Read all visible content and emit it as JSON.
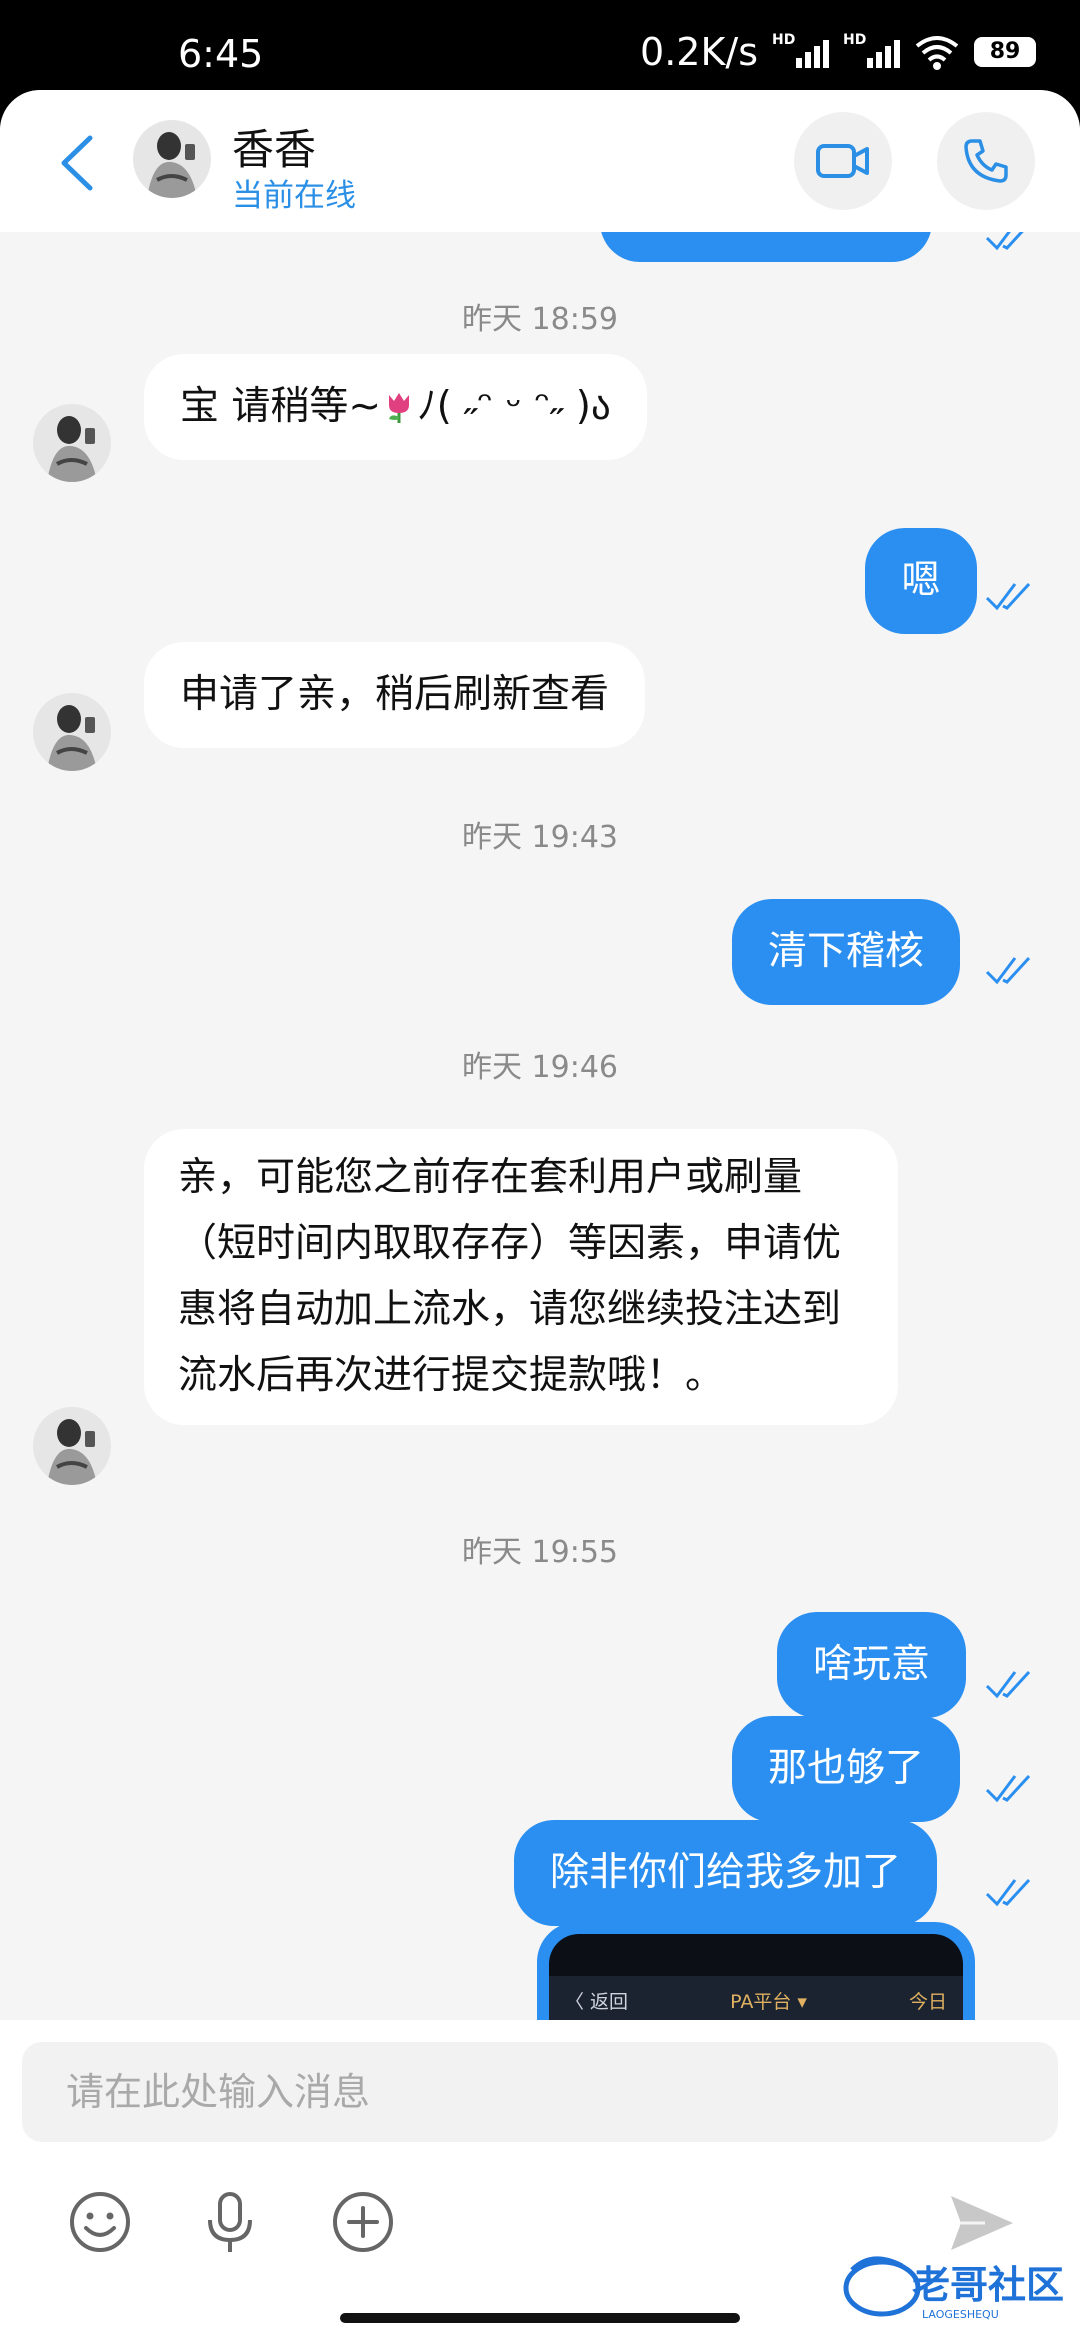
{
  "status_bar": {
    "time": "6:45",
    "net_speed": "0.2K/s",
    "signal_tag": "HD",
    "battery": "89"
  },
  "header": {
    "contact_name": "香香",
    "contact_status": "当前在线"
  },
  "messages": {
    "t1": "昨天 18:59",
    "m1": "宝 请稍等~",
    "m1_kaomoji": "ﾉ( ˶ᵔ ᵕ ᵔ˶ )ა",
    "m2": "嗯",
    "m3": "申请了亲，稍后刷新查看",
    "t2": "昨天 19:43",
    "m4": "清下稽核",
    "t3": "昨天 19:46",
    "m5": "亲，可能您之前存在套利用户或刷量（短时间内取取存存）等因素，申请优惠将自动加上流水，请您继续投注达到流水后再次进行提交提款哦！。",
    "t4": "昨天 19:55",
    "m6": "啥玩意",
    "m7": "那也够了",
    "m8": "除非你们给我多加了",
    "img_back": "〈 返回",
    "img_title": "PA平台 ▾",
    "img_right": "今日"
  },
  "input": {
    "placeholder": "请在此处输入消息"
  },
  "watermark": {
    "text": "老哥社区",
    "subtext": "LAOGESHEQU"
  },
  "colors": {
    "accent": "#2a8ff0",
    "background": "#f5f5f5"
  }
}
